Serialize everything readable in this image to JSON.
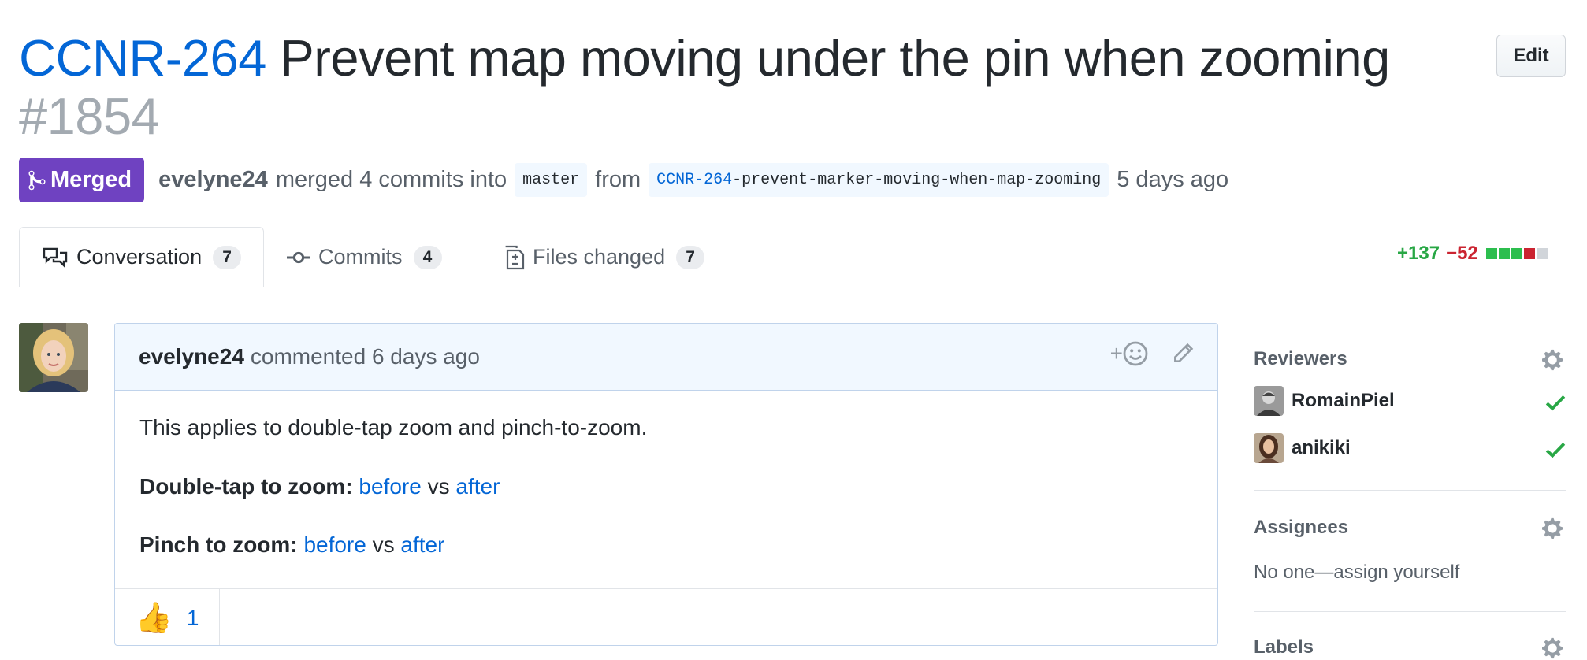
{
  "title": {
    "issue_key": "CCNR-264",
    "text": "Prevent map moving under the pin when zooming",
    "number": "#1854"
  },
  "edit_label": "Edit",
  "meta": {
    "status": "Merged",
    "author": "evelyne24",
    "merged_text": "merged 4 commits into",
    "base_branch": "master",
    "from_text": "from",
    "head_branch_key": "CCNR-264",
    "head_branch_rest": "-prevent-marker-moving-when-map-zooming",
    "time": "5 days ago"
  },
  "tabs": [
    {
      "label": "Conversation",
      "count": "7",
      "icon": "comment-discussion-icon",
      "selected": true
    },
    {
      "label": "Commits",
      "count": "4",
      "icon": "git-commit-icon",
      "selected": false
    },
    {
      "label": "Files changed",
      "count": "7",
      "icon": "file-diff-icon",
      "selected": false
    }
  ],
  "diffstat": {
    "additions": "+137",
    "deletions": "−52",
    "blocks": [
      "#2cbe4e",
      "#2cbe4e",
      "#2cbe4e",
      "#cb2431",
      "#d1d5da"
    ]
  },
  "comment": {
    "author": "evelyne24",
    "action": "commented 6 days ago",
    "body_line1": "This applies to double-tap zoom and pinch-to-zoom.",
    "double_tap_label": "Double-tap to zoom:",
    "pinch_label": "Pinch to zoom:",
    "before": "before",
    "vs": "vs",
    "after": "after",
    "reaction_emoji": "👍",
    "reaction_count": "1",
    "add_reaction": "+"
  },
  "sidebar": {
    "reviewers_heading": "Reviewers",
    "reviewers": [
      {
        "name": "RomainPiel",
        "status": "approved"
      },
      {
        "name": "anikiki",
        "status": "approved"
      }
    ],
    "assignees_heading": "Assignees",
    "assignees_text": "No one—assign yourself",
    "labels_heading": "Labels"
  },
  "colors": {
    "link": "#0366d6",
    "merged": "#6f42c1",
    "addition": "#28a745",
    "deletion": "#cb2431"
  }
}
